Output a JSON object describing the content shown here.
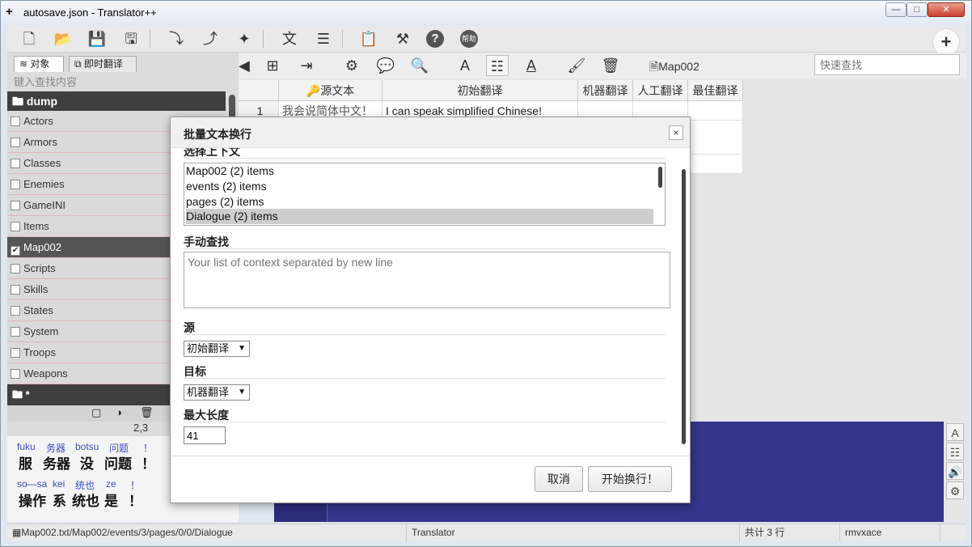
{
  "window": {
    "logo": "+",
    "title": "autosave.json - Translator++",
    "min": "—",
    "max": "□",
    "close": "✕"
  },
  "toolbar": {
    "icons": [
      "new-file-icon",
      "open-folder-icon",
      "save-icon",
      "save-as-icon",
      "import-icon",
      "export-icon",
      "wand-icon",
      "translate-icon",
      "list-icon",
      "clipboard-icon",
      "tools-icon",
      "help-icon",
      "help-badge-icon"
    ],
    "help_badge": "帮助"
  },
  "left_panel": {
    "tab_objects": "对象",
    "tab_instant": "即时翻译",
    "search_placeholder": "键入查找内容",
    "root_folder": "dump",
    "items": [
      {
        "label": "Actors",
        "checked": false
      },
      {
        "label": "Armors",
        "checked": false
      },
      {
        "label": "Classes",
        "checked": false
      },
      {
        "label": "Enemies",
        "checked": false
      },
      {
        "label": "GameINI",
        "checked": false
      },
      {
        "label": "Items",
        "checked": false
      },
      {
        "label": "Map002",
        "checked": true
      },
      {
        "label": "Scripts",
        "checked": false
      },
      {
        "label": "Skills",
        "checked": false
      },
      {
        "label": "States",
        "checked": false
      },
      {
        "label": "System",
        "checked": false
      },
      {
        "label": "Troops",
        "checked": false
      },
      {
        "label": "Weapons",
        "checked": false
      }
    ],
    "star_folder": "*",
    "coord": "2,3",
    "furigana_line1": {
      "readings": [
        "fuku",
        "务器",
        "botsu",
        "问题",
        "！"
      ],
      "words": [
        "服",
        "务器",
        "没",
        "问题",
        "！"
      ]
    },
    "furigana_line2": {
      "readings": [
        "so—sa",
        "kei",
        "统也",
        "ze",
        "！"
      ],
      "words": [
        "操作",
        "系",
        "统也",
        "是",
        "！"
      ]
    }
  },
  "toolbar2": {
    "map_label": "Map002",
    "quick_search_placeholder": "快速查找"
  },
  "grid": {
    "headers": [
      "源文本",
      "初始翻译",
      "机器翻译",
      "人工翻译",
      "最佳翻译"
    ],
    "rows": [
      {
        "index": "1",
        "source": "我会说简体中文！",
        "initial": "I can speak simplified Chinese!"
      }
    ]
  },
  "dialog": {
    "title": "批量文本换行",
    "close": "×",
    "context_label": "选择上下文",
    "context_items": [
      "Map002 (2) items",
      "events (2) items",
      "pages (2) items",
      "Dialogue (2) items"
    ],
    "manual_label": "手动查找",
    "manual_placeholder": "Your list of context separated by new line",
    "source_label": "源",
    "source_value": "初始翻译",
    "target_label": "目标",
    "target_value": "机器翻译",
    "maxlen_label": "最大长度",
    "maxlen_value": "41",
    "cancel": "取消",
    "start": "开始换行！"
  },
  "statusbar": {
    "path": "Map002.txt/Map002/events/3/pages/0/0/Dialogue",
    "app": "Translator",
    "count": "共计 3 行",
    "engine": "rmvxace"
  }
}
